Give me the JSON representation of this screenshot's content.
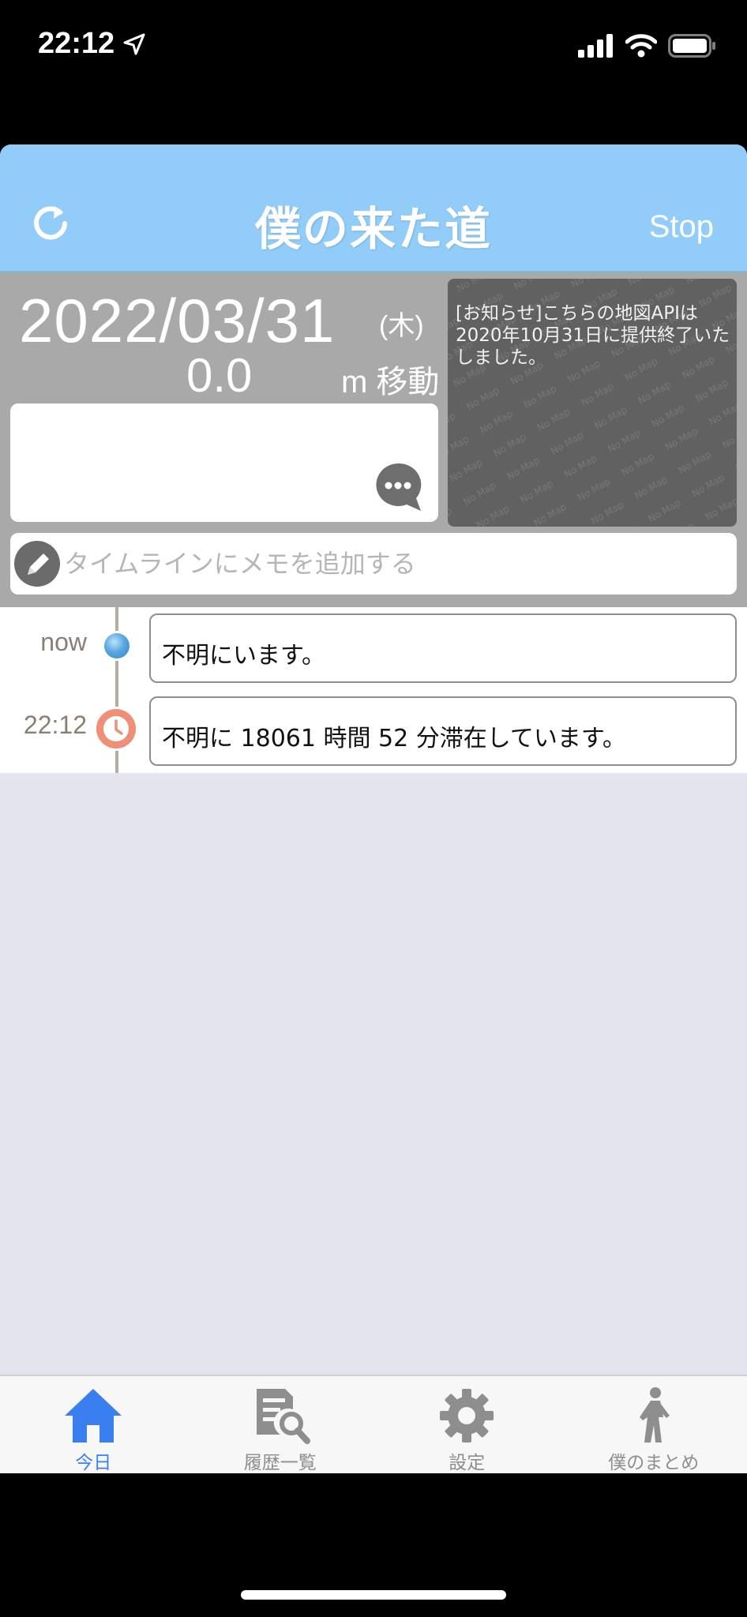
{
  "status_bar": {
    "time": "22:12"
  },
  "nav": {
    "title": "僕の来た道",
    "stop_label": "Stop"
  },
  "summary": {
    "date": "2022/03/31",
    "weekday": "(木)",
    "distance": "0.0",
    "distance_unit": "m 移動",
    "map_notice": "[お知らせ]こちらの地図APIは2020年10月31日に提供終了いたしました。",
    "map_watermark": "No Map",
    "memo_placeholder": "タイムラインにメモを追加する"
  },
  "timeline": {
    "entries": [
      {
        "time": "now",
        "text": "不明にいます。",
        "marker": "location"
      },
      {
        "time": "22:12",
        "text": "不明に 18061 時間 52 分滞在しています。",
        "marker": "clock"
      }
    ]
  },
  "tabs": [
    {
      "label": "今日",
      "icon": "home-icon",
      "active": true
    },
    {
      "label": "履歴一覧",
      "icon": "history-search-icon",
      "active": false
    },
    {
      "label": "設定",
      "icon": "gear-icon",
      "active": false
    },
    {
      "label": "僕のまとめ",
      "icon": "walker-icon",
      "active": false
    }
  ],
  "colors": {
    "nav": "#92cdfa",
    "accent": "#3a7ff0",
    "panel": "#a9a9a9",
    "background": "#e4e4ef"
  }
}
